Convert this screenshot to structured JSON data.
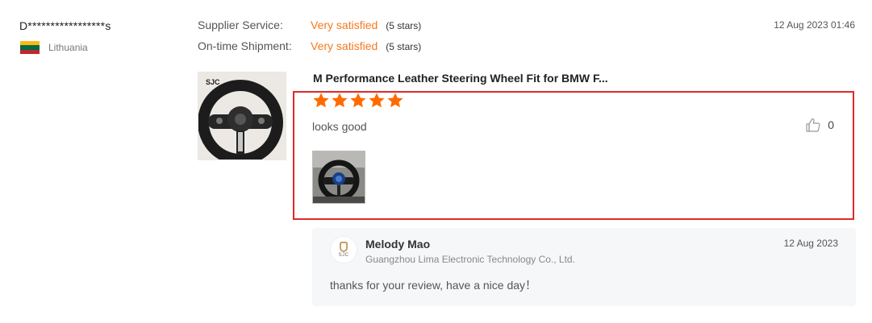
{
  "reviewer": {
    "name": "D*****************s",
    "country": "Lithuania",
    "flag_colors": [
      "#fdb913",
      "#006a44",
      "#c1272d"
    ]
  },
  "ratings": [
    {
      "label": "Supplier Service:",
      "value": "Very satisfied",
      "stars": "(5 stars)"
    },
    {
      "label": "On-time Shipment:",
      "value": "Very satisfied",
      "stars": "(5 stars)"
    }
  ],
  "review": {
    "date": "12 Aug 2023 01:46",
    "product_title": "M Performance Leather Steering Wheel Fit for BMW F...",
    "product_thumb_text": "SJC",
    "star_rating": 5,
    "text": "looks good",
    "helpful_count": "0",
    "photo_count": 1
  },
  "reply": {
    "supplier_name": "Melody Mao",
    "company": "Guangzhou Lima Electronic Technology Co., Ltd.",
    "date": "12 Aug 2023",
    "text": "thanks for your review, have a nice day！",
    "avatar_text": "SJC"
  },
  "colors": {
    "accent_orange": "#f47a20",
    "star_orange": "#ff6a00",
    "highlight_red": "#e0282a",
    "reply_bg": "#f6f7f9"
  },
  "icons": {
    "helpful": "thumbs-up-icon",
    "star": "star-icon",
    "flag": "lithuania-flag-icon"
  }
}
